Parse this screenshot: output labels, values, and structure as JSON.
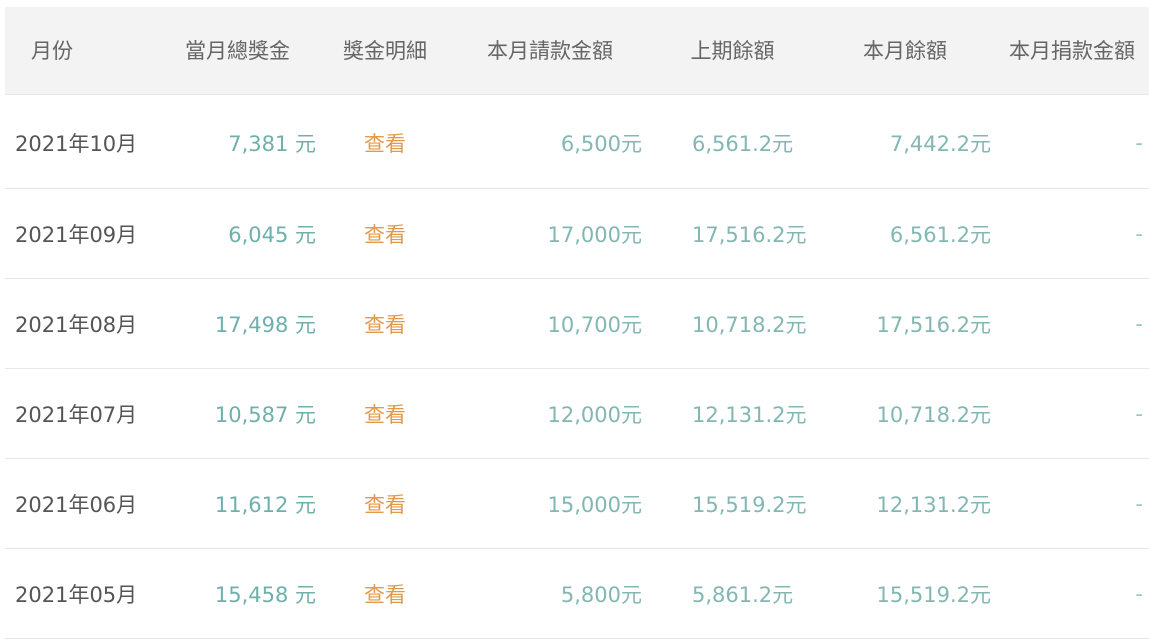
{
  "table": {
    "headers": {
      "month": "月份",
      "total_bonus": "當月總獎金",
      "bonus_detail": "獎金明細",
      "request_amount": "本月請款金額",
      "prev_balance": "上期餘額",
      "current_balance": "本月餘額",
      "donation": "本月捐款金額"
    },
    "rows": [
      {
        "month": "2021年10月",
        "total_bonus": "7,381 元",
        "detail": "查看",
        "request_amount": "6,500元",
        "prev_balance": "6,561.2元",
        "current_balance": "7,442.2元",
        "donation": "-"
      },
      {
        "month": "2021年09月",
        "total_bonus": "6,045 元",
        "detail": "查看",
        "request_amount": "17,000元",
        "prev_balance": "17,516.2元",
        "current_balance": "6,561.2元",
        "donation": "-"
      },
      {
        "month": "2021年08月",
        "total_bonus": "17,498 元",
        "detail": "查看",
        "request_amount": "10,700元",
        "prev_balance": "10,718.2元",
        "current_balance": "17,516.2元",
        "donation": "-"
      },
      {
        "month": "2021年07月",
        "total_bonus": "10,587 元",
        "detail": "查看",
        "request_amount": "12,000元",
        "prev_balance": "12,131.2元",
        "current_balance": "10,718.2元",
        "donation": "-"
      },
      {
        "month": "2021年06月",
        "total_bonus": "11,612 元",
        "detail": "查看",
        "request_amount": "15,000元",
        "prev_balance": "15,519.2元",
        "current_balance": "12,131.2元",
        "donation": "-"
      },
      {
        "month": "2021年05月",
        "total_bonus": "15,458 元",
        "detail": "查看",
        "request_amount": "5,800元",
        "prev_balance": "5,861.2元",
        "current_balance": "15,519.2元",
        "donation": "-"
      }
    ]
  },
  "colors": {
    "header_bg": "#f3f3f3",
    "value_teal": "#82b7b2",
    "link_orange": "#e29a4a",
    "month_text": "#555555"
  }
}
